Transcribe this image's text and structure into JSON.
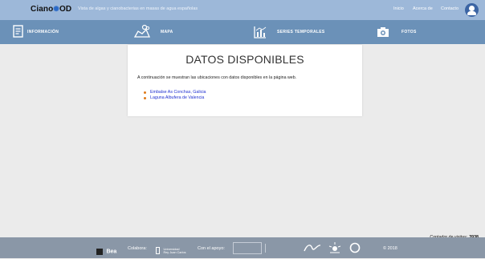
{
  "header": {
    "logo": {
      "prefix": "Ciano",
      "o": "M",
      "suffix": "OD"
    },
    "tagline": "Vista de algas y cianobacterias en masas de agua españolas",
    "links": [
      {
        "label": "Inicio"
      },
      {
        "label": "Acerca de"
      },
      {
        "label": "Contacto"
      }
    ],
    "avatar_icon": "user-circle-icon"
  },
  "nav": {
    "items": [
      {
        "label": "INFORMACIÓN",
        "icon": "document-icon"
      },
      {
        "label": "MAPA",
        "icon": "map-pin-icon"
      },
      {
        "label": "SERIES TEMPORALES",
        "icon": "bar-chart-icon"
      },
      {
        "label": "FOTOS",
        "icon": "camera-icon"
      }
    ]
  },
  "main": {
    "title": "DATOS DISPONIBLES",
    "intro": "A continuación se muestran las ubicaciones con datos disponibles en la página web.",
    "locations": [
      {
        "label": "Embalse As Conchas, Galicia"
      },
      {
        "label": "Laguna Albufera de Valencia"
      }
    ]
  },
  "footer": {
    "counter_label": "Contador de visitas:",
    "counter_value": "3938",
    "partner1": "Bea",
    "collaborate": "Colabora:",
    "urjc": "Universidad\nRey Juan Carlos",
    "support": "Con el apoyo:",
    "year": "© 2018"
  },
  "colors": {
    "topbar": "#9db8d9",
    "navbar": "#6b91b8",
    "link": "#1f2fd0",
    "bullet": "#e07a1a",
    "footer": "#8a97a7"
  }
}
